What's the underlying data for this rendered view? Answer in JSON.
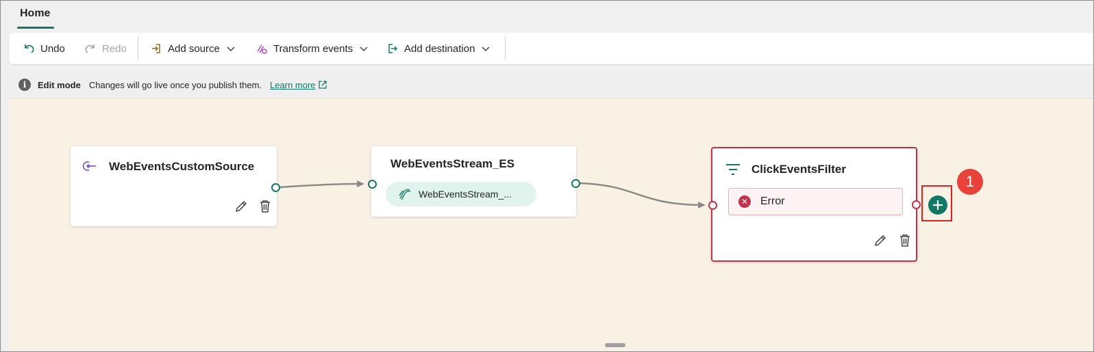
{
  "tabs": {
    "home": "Home"
  },
  "toolbar": {
    "undo": "Undo",
    "redo": "Redo",
    "add_source": "Add source",
    "transform_events": "Transform events",
    "add_destination": "Add destination"
  },
  "infobar": {
    "title": "Edit mode",
    "text": "Changes will go live once you publish them.",
    "link": "Learn more"
  },
  "nodes": {
    "source": {
      "title": "WebEventsCustomSource"
    },
    "stream": {
      "title": "WebEventsStream_ES",
      "pill": "WebEventsStream_..."
    },
    "filter": {
      "title": "ClickEventsFilter",
      "status": "Error"
    }
  },
  "callout": "1",
  "colors": {
    "accent": "#117865",
    "error": "#c4314b",
    "callout": "#e8423a",
    "canvas": "#f9f1e3"
  }
}
